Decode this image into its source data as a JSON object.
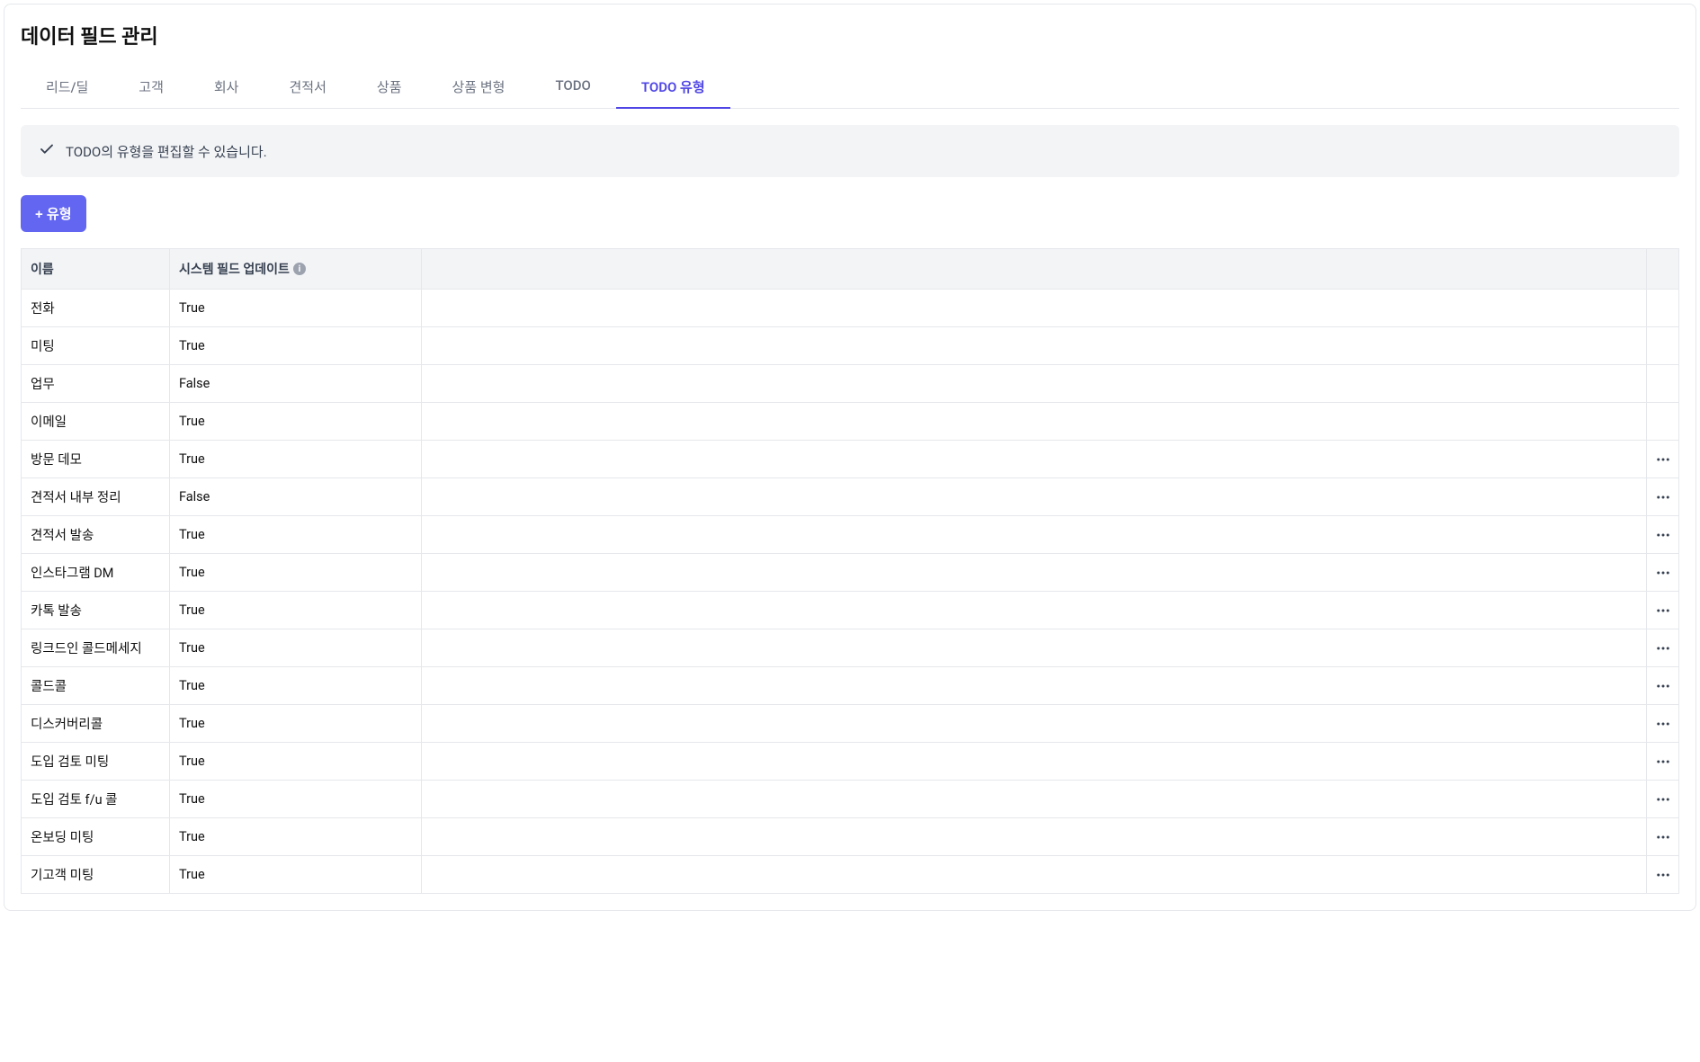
{
  "page": {
    "title": "데이터 필드 관리"
  },
  "tabs": [
    {
      "label": "리드/딜",
      "active": false
    },
    {
      "label": "고객",
      "active": false
    },
    {
      "label": "회사",
      "active": false
    },
    {
      "label": "견적서",
      "active": false
    },
    {
      "label": "상품",
      "active": false
    },
    {
      "label": "상품 변형",
      "active": false
    },
    {
      "label": "TODO",
      "active": false
    },
    {
      "label": "TODO 유형",
      "active": true
    }
  ],
  "banner": {
    "text": "TODO의 유형을 편집할 수 있습니다."
  },
  "addButton": {
    "label": "+ 유형"
  },
  "table": {
    "headers": {
      "name": "이름",
      "systemFieldUpdate": "시스템 필드 업데이트"
    },
    "rows": [
      {
        "name": "전화",
        "systemFieldUpdate": "True",
        "hasMore": false
      },
      {
        "name": "미팅",
        "systemFieldUpdate": "True",
        "hasMore": false
      },
      {
        "name": "업무",
        "systemFieldUpdate": "False",
        "hasMore": false
      },
      {
        "name": "이메일",
        "systemFieldUpdate": "True",
        "hasMore": false
      },
      {
        "name": "방문 데모",
        "systemFieldUpdate": "True",
        "hasMore": true
      },
      {
        "name": "견적서 내부 정리",
        "systemFieldUpdate": "False",
        "hasMore": true
      },
      {
        "name": "견적서 발송",
        "systemFieldUpdate": "True",
        "hasMore": true
      },
      {
        "name": "인스타그램 DM",
        "systemFieldUpdate": "True",
        "hasMore": true
      },
      {
        "name": "카톡 발송",
        "systemFieldUpdate": "True",
        "hasMore": true
      },
      {
        "name": "링크드인 콜드메세지",
        "systemFieldUpdate": "True",
        "hasMore": true
      },
      {
        "name": "콜드콜",
        "systemFieldUpdate": "True",
        "hasMore": true
      },
      {
        "name": "디스커버리콜",
        "systemFieldUpdate": "True",
        "hasMore": true
      },
      {
        "name": "도입 검토 미팅",
        "systemFieldUpdate": "True",
        "hasMore": true
      },
      {
        "name": "도입 검토 f/u 콜",
        "systemFieldUpdate": "True",
        "hasMore": true
      },
      {
        "name": "온보딩 미팅",
        "systemFieldUpdate": "True",
        "hasMore": true
      },
      {
        "name": "기고객 미팅",
        "systemFieldUpdate": "True",
        "hasMore": true
      }
    ]
  }
}
